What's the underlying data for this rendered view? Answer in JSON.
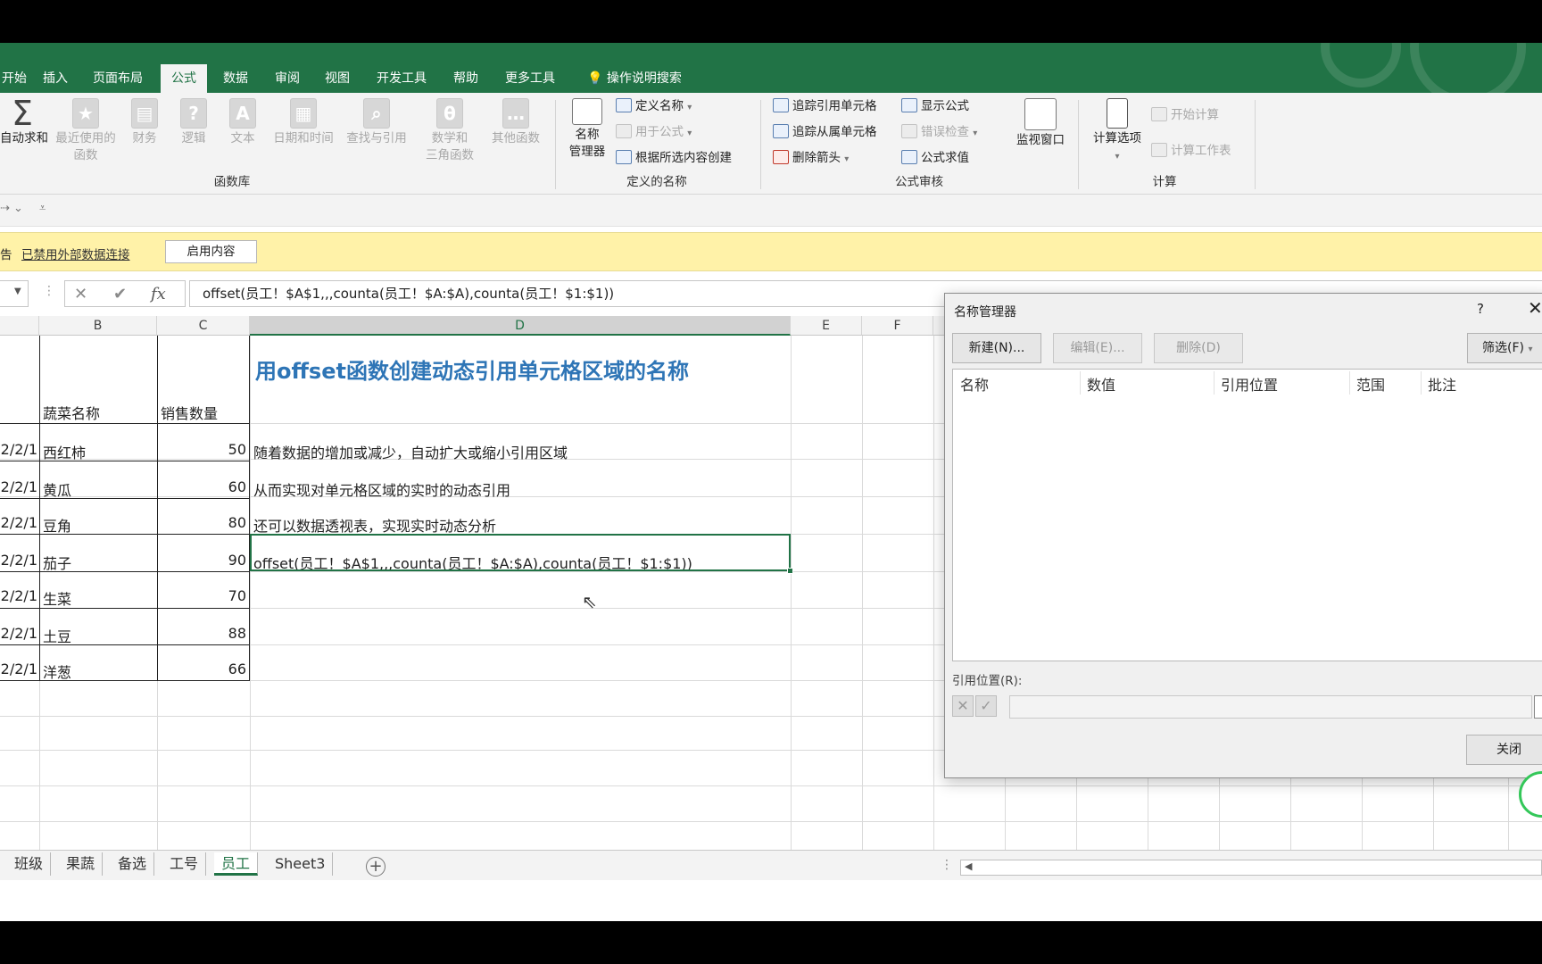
{
  "tabs": [
    "开始",
    "插入",
    "页面布局",
    "公式",
    "数据",
    "审阅",
    "视图",
    "开发工具",
    "帮助",
    "更多工具",
    "操作说明搜索"
  ],
  "active_tab": "公式",
  "ribbon": {
    "function_library": {
      "autosum": "自动求和",
      "recent_line1": "最近使用的",
      "recent_line2": "函数",
      "financial": "财务",
      "logical": "逻辑",
      "text": "文本",
      "datetime": "日期和时间",
      "lookup": "查找与引用",
      "math_line1": "数学和",
      "math_line2": "三角函数",
      "other": "其他函数",
      "group_label": "函数库"
    },
    "defined_names": {
      "name_manager_line1": "名称",
      "name_manager_line2": "管理器",
      "define_name": "定义名称",
      "use_in_formula": "用于公式",
      "create_from_selection": "根据所选内容创建",
      "group_label": "定义的名称"
    },
    "formula_auditing": {
      "trace_precedents": "追踪引用单元格",
      "trace_dependents": "追踪从属单元格",
      "remove_arrows": "删除箭头",
      "show_formulas": "显示公式",
      "error_checking": "错误检查",
      "evaluate_formula": "公式求值",
      "watch_window": "监视窗口",
      "group_label": "公式审核"
    },
    "calculation": {
      "calc_options": "计算选项",
      "calc_now": "开始计算",
      "calc_sheet": "计算工作表",
      "group_label": "计算"
    }
  },
  "message_bar": {
    "prefix": "告",
    "message": "已禁用外部数据连接",
    "button": "启用内容"
  },
  "formula_bar": {
    "cancel_icon": "✕",
    "enter_icon": "✔",
    "fx_label": "fx",
    "formula": "offset(员工！$A$1,,,counta(员工！$A:$A),counta(员工！$1:$1))"
  },
  "columns": [
    "B",
    "C",
    "D",
    "E",
    "F"
  ],
  "selected_column": "D",
  "table": {
    "headers": [
      "蔬菜名称",
      "销售数量"
    ],
    "rows": [
      {
        "date": "2/2/1",
        "name": "西红柿",
        "qty": "50"
      },
      {
        "date": "2/2/1",
        "name": "黄瓜",
        "qty": "60"
      },
      {
        "date": "2/2/1",
        "name": "豆角",
        "qty": "80"
      },
      {
        "date": "2/2/1",
        "name": "茄子",
        "qty": "90"
      },
      {
        "date": "2/2/1",
        "name": "生菜",
        "qty": "70"
      },
      {
        "date": "2/2/1",
        "name": "土豆",
        "qty": "88"
      },
      {
        "date": "2/2/1",
        "name": "洋葱",
        "qty": "66"
      }
    ]
  },
  "notes": {
    "title": "用offset函数创建动态引用单元格区域的名称",
    "line1": "随着数据的增加或减少，自动扩大或缩小引用区域",
    "line2": "从而实现对单元格区域的实时的动态引用",
    "line3": "还可以数据透视表，实现实时动态分析",
    "formula": "offset(员工！$A$1,,,counta(员工！$A:$A),counta(员工！$1:$1))"
  },
  "sheet_tabs": [
    "班级",
    "果蔬",
    "备选",
    "工号",
    "员工",
    "Sheet3"
  ],
  "active_sheet": "员工",
  "dialog": {
    "title": "名称管理器",
    "help": "?",
    "close_x": "✕",
    "buttons": {
      "new": "新建(N)...",
      "edit": "编辑(E)...",
      "delete": "删除(D)",
      "filter": "筛选(F)"
    },
    "list_columns": [
      "名称",
      "数值",
      "引用位置",
      "范围",
      "批注"
    ],
    "refers_to_label": "引用位置(R):",
    "close_button": "关闭"
  },
  "colors": {
    "brand_green": "#217346",
    "title_blue": "#2e75b6",
    "message_yellow": "#fff2a8"
  }
}
